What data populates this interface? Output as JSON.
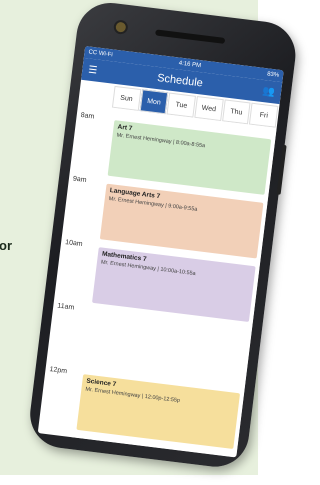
{
  "page": {
    "side_text": "or"
  },
  "phone": {
    "status_bar": {
      "carrier": "CC Wi-Fi",
      "time": "4:16 PM",
      "battery": "83%"
    },
    "app_bar": {
      "title": "Schedule",
      "menu_icon": "menu-icon",
      "people_icon": "people-icon"
    },
    "days": [
      "Sun",
      "Mon",
      "Tue",
      "Wed",
      "Thu",
      "Fri"
    ],
    "active_day": "Mon",
    "times": [
      "8am",
      "9am",
      "10am",
      "11am",
      "12pm"
    ],
    "events": [
      {
        "title": "Art 7",
        "detail": "Mr. Ernest Hemingway | 8:00a-8:55a",
        "color": "#cfe8c8"
      },
      {
        "title": "Language Arts 7",
        "detail": "Mr. Ernest Hemingway | 9:00a-9:55a",
        "color": "#f2d0b8"
      },
      {
        "title": "Mathematics 7",
        "detail": "Mr. Ernest Hemingway | 10:00a-10:55a",
        "color": "#d9cde6"
      },
      {
        "title": "Science 7",
        "detail": "Mr. Ernest Hemingway | 12:00p-12:55p",
        "color": "#f6df9c"
      }
    ]
  }
}
